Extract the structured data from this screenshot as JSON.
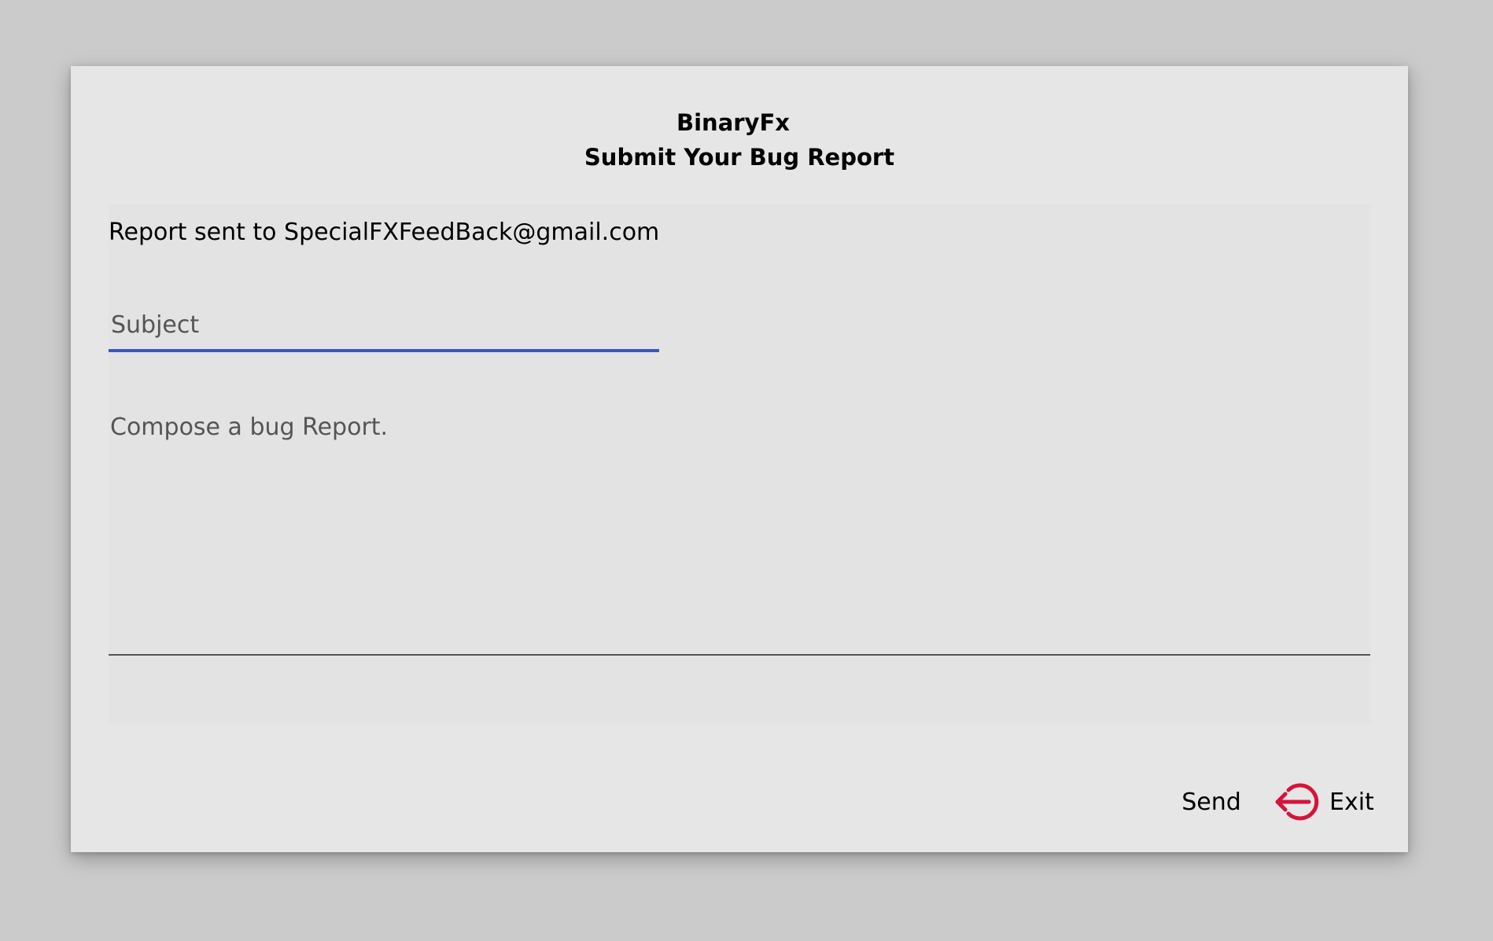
{
  "header": {
    "app_title": "BinaryFx",
    "subtitle": "Submit Your Bug Report"
  },
  "form": {
    "recipient_text": "Report sent to SpecialFXFeedBack@gmail.com",
    "subject_placeholder": "Subject",
    "body_placeholder": "Compose a bug Report."
  },
  "actions": {
    "send_label": "Send",
    "exit_label": "Exit",
    "exit_icon": "exit-arrow-icon",
    "exit_icon_color": "#d6143a"
  },
  "colors": {
    "subject_underline": "#3e56b3"
  }
}
